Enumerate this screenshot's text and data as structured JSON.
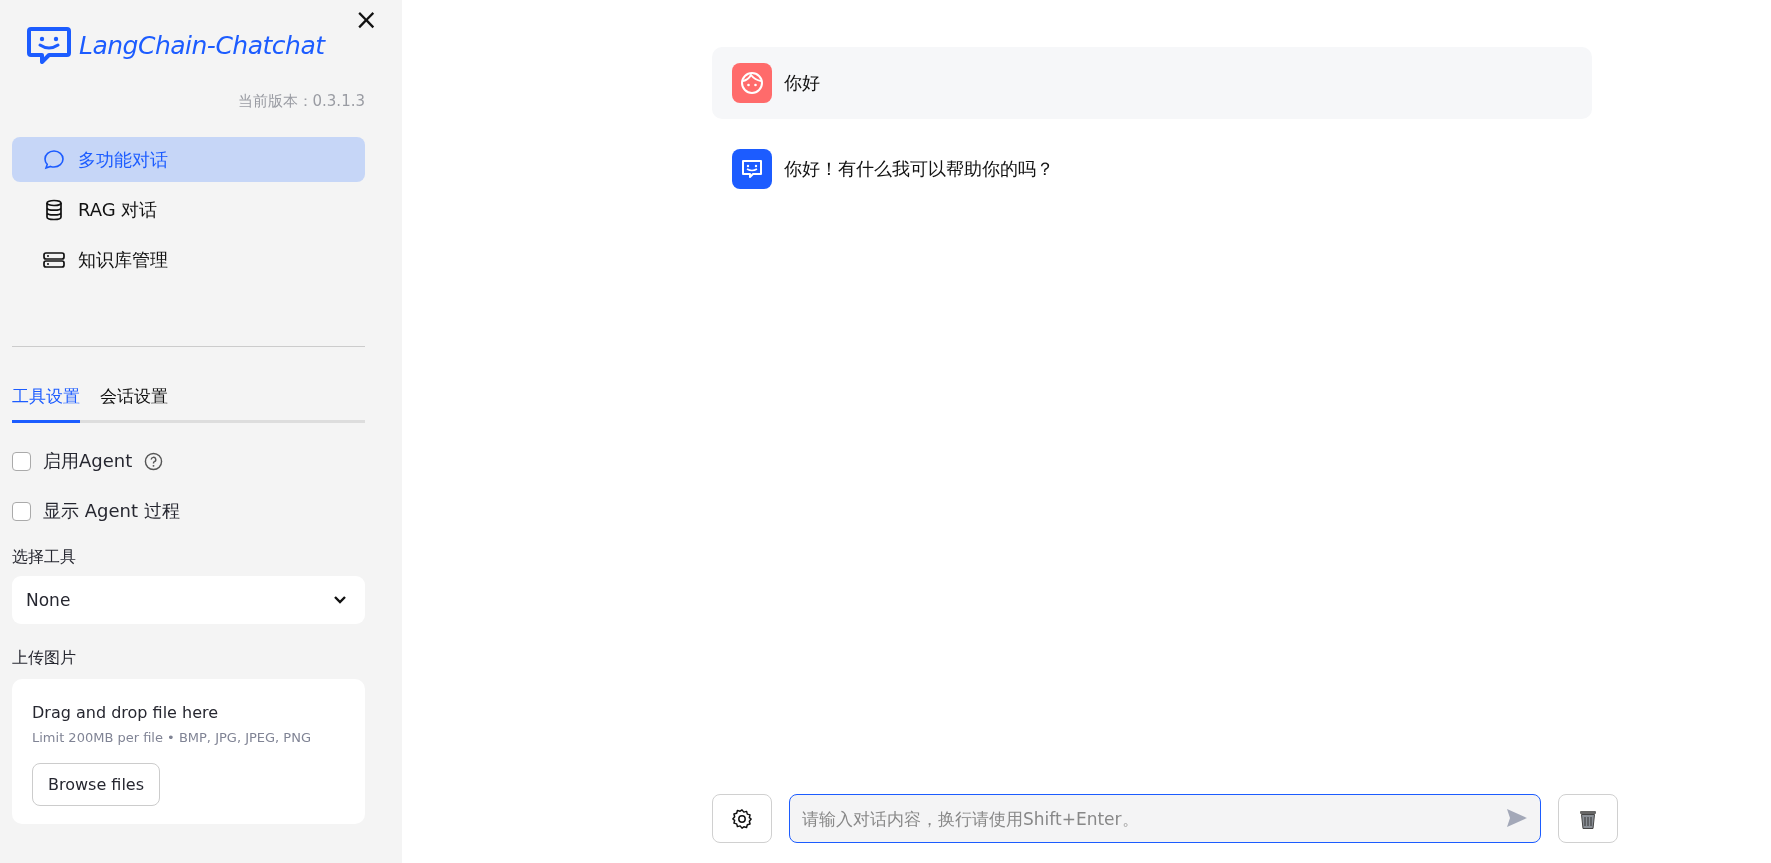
{
  "sidebar": {
    "logo_text": "LangChain-Chatchat",
    "close": "×",
    "version": "当前版本：0.3.1.3",
    "nav": [
      {
        "label": "多功能对话",
        "kind": "chat",
        "selected": true
      },
      {
        "label": "RAG 对话",
        "kind": "database",
        "selected": false
      },
      {
        "label": "知识库管理",
        "kind": "server",
        "selected": false
      }
    ],
    "tabs": [
      {
        "label": "工具设置",
        "selected": true
      },
      {
        "label": "会话设置",
        "selected": false
      }
    ],
    "options": [
      {
        "label": "启用Agent",
        "checked": false,
        "help": true
      },
      {
        "label": "显示 Agent 过程",
        "checked": false,
        "help": false
      }
    ],
    "tool_select": {
      "label": "选择工具",
      "value": "None"
    },
    "upload": {
      "label": "上传图片",
      "title": "Drag and drop file here",
      "hint": "Limit 200MB per file • BMP, JPG, JPEG, PNG",
      "button": "Browse files"
    }
  },
  "messages": [
    {
      "kind": "user",
      "text": "你好"
    },
    {
      "kind": "assistant",
      "text": "你好！有什么我可以帮助你的吗？"
    }
  ],
  "input": {
    "placeholder": "请输入对话内容，换行请使用Shift+Enter。"
  }
}
